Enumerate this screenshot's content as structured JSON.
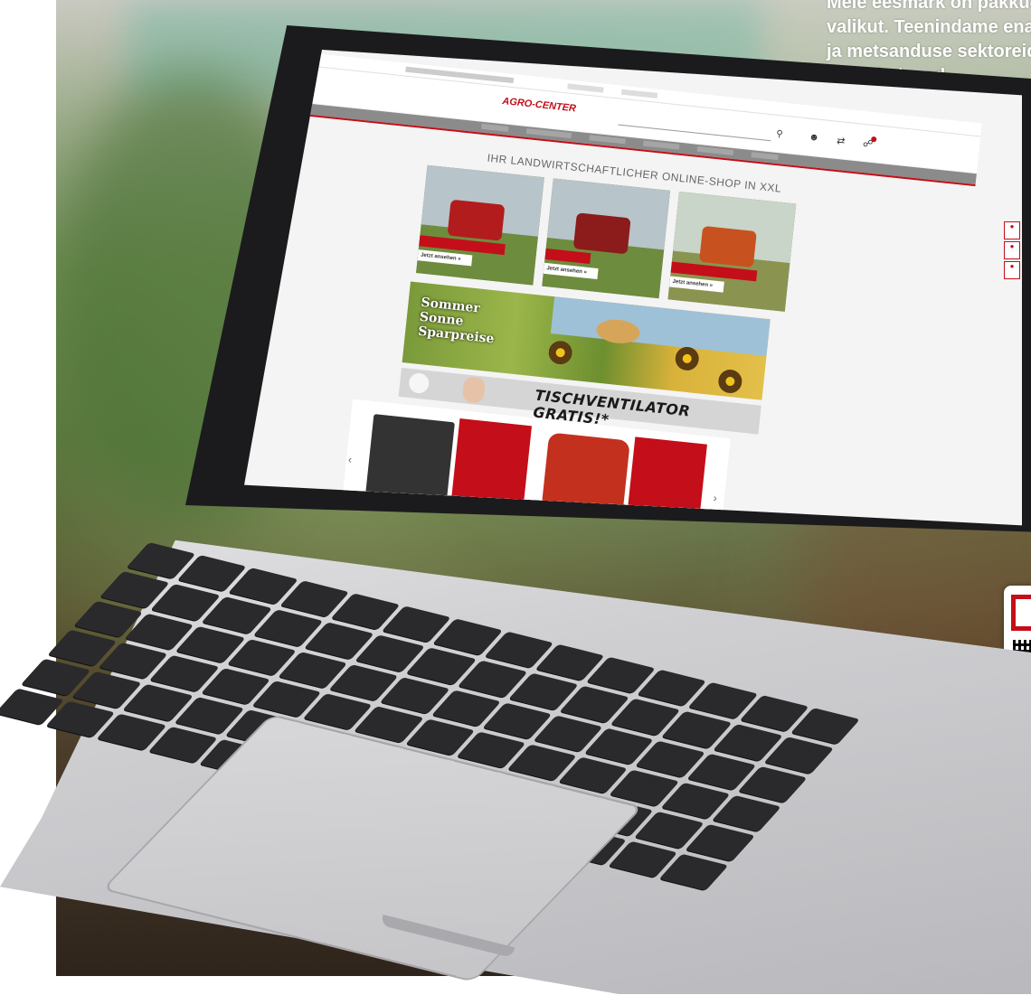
{
  "caption": {
    "lines": [
      "Meie eesmärk on pakkud",
      "valikut. Teenindame ena",
      "ja metsanduse sektoreid",
      "aia vajadused."
    ]
  },
  "screen": {
    "logo": "AGRO-CENTER",
    "headline": "IHR LANDWIRTSCHAFTLICHER ONLINE-SHOP IN XXL",
    "tiles": [
      {
        "cta": "Jetzt ansehen »"
      },
      {
        "cta": "Jetzt ansehen »"
      },
      {
        "cta": "Jetzt ansehen »"
      }
    ],
    "banner_promo": [
      "Sommer",
      "Sonne",
      "Sparpreise"
    ],
    "strip_text": "TISCHVENTILATOR GRATIS!*"
  },
  "icons": [
    "search-icon",
    "user-icon",
    "cart-icon",
    "compare-icon",
    "chevron-left-icon",
    "chevron-right-icon"
  ],
  "colors": {
    "brand_red": "#c40e19",
    "caption_text": "#ffffff"
  }
}
